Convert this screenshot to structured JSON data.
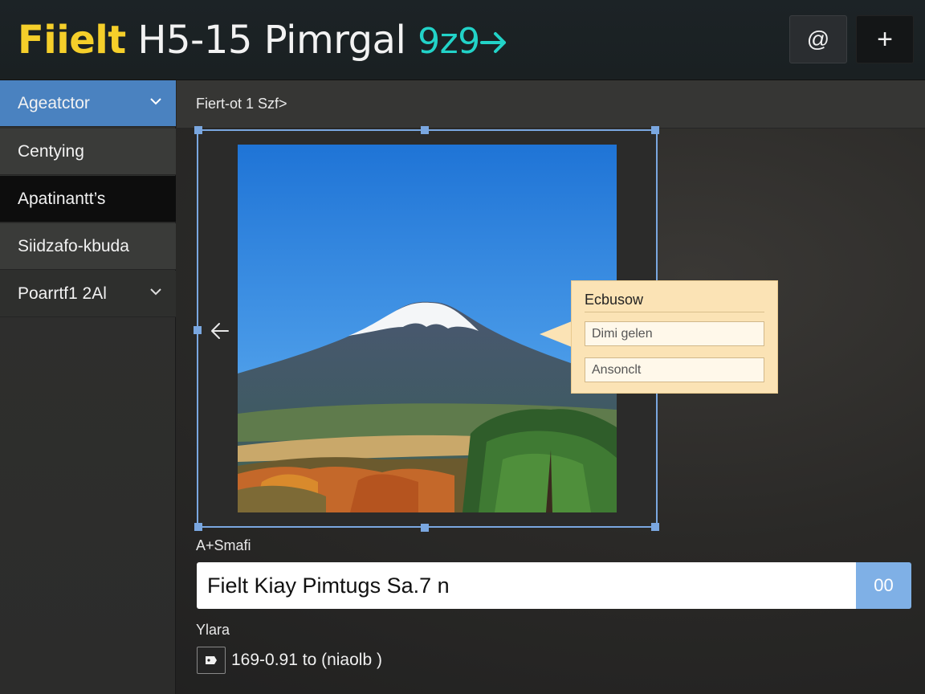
{
  "window": {
    "title_part1": "Fiielt",
    "title_part2": "H5-15 Pimrgal",
    "title_part3": "9z9",
    "arrow_icon": "arrow-right-icon",
    "at_button_label": "@",
    "add_button_label": "+"
  },
  "sidebar": {
    "items": [
      {
        "label": "Ageatctor",
        "icon": "chevron-down-icon"
      },
      {
        "label": "Centying"
      },
      {
        "label": "Apatinantt’s"
      },
      {
        "label": "Siidzafo-kbuda"
      },
      {
        "label": "Poarrtf1 2Al",
        "icon": "chevron-down-icon"
      }
    ]
  },
  "content": {
    "breadcrumb": "Fiert-ot 1 Szf>",
    "image": {
      "subject": "snow-capped mountain landscape"
    },
    "popup": {
      "title": "Ecbusow",
      "field1_value": "Dimi gelen",
      "field2_value": "Ansonclt"
    },
    "name_label": "A+Smafi",
    "name_value": "Fielt Kiay Pimtugs Sa.7 n",
    "name_button": "00",
    "range_label": "Ylara",
    "range_value": "169-0.91 to  (niaolb )"
  },
  "colors": {
    "accent": "#4a82c0",
    "title_yellow": "#f5cf2a",
    "title_teal": "#22d3c8",
    "popup_bg": "#fbe3b5",
    "selection": "#7aa7e0"
  }
}
